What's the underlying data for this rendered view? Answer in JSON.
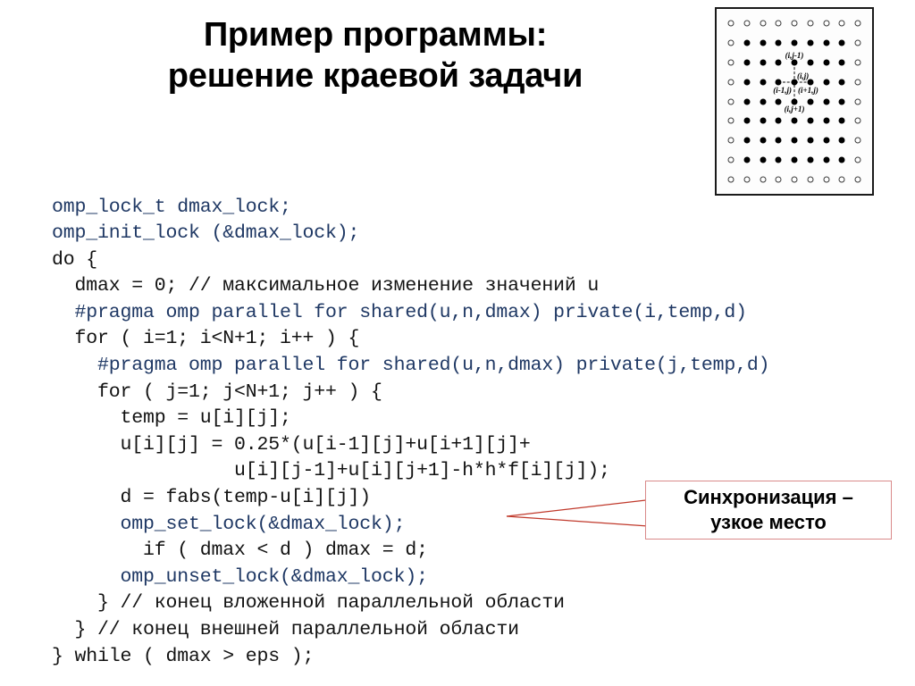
{
  "slide": {
    "title_lines": [
      "Пример программы:",
      "решение краевой задачи"
    ]
  },
  "grid_figure": {
    "name": "finite-difference-stencil-grid",
    "rows": 9,
    "cols": 9,
    "labels": [
      {
        "id": "up",
        "text": "(i,j-1)"
      },
      {
        "id": "center",
        "text": "(i,j)"
      },
      {
        "id": "left",
        "text": "(i-1,j)"
      },
      {
        "id": "right",
        "text": "(i+1,j)"
      },
      {
        "id": "down",
        "text": "(i,j+1)"
      }
    ]
  },
  "code": {
    "language": "c-openmp",
    "lines": [
      {
        "text": "omp_lock_t dmax_lock;",
        "color": "blue"
      },
      {
        "text": "omp_init_lock (&dmax_lock);",
        "color": "blue"
      },
      {
        "text": "do {",
        "color": "black"
      },
      {
        "text": "  dmax = 0; // максимальное изменение значений u",
        "color": "black"
      },
      {
        "text": "  #pragma omp parallel for shared(u,n,dmax) private(i,temp,d)",
        "color": "blue"
      },
      {
        "text": "  for ( i=1; i<N+1; i++ ) {",
        "color": "black"
      },
      {
        "text": "    #pragma omp parallel for shared(u,n,dmax) private(j,temp,d)",
        "color": "blue"
      },
      {
        "text": "    for ( j=1; j<N+1; j++ ) {",
        "color": "black"
      },
      {
        "text": "      temp = u[i][j];",
        "color": "black"
      },
      {
        "text": "      u[i][j] = 0.25*(u[i-1][j]+u[i+1][j]+",
        "color": "black"
      },
      {
        "text": "                u[i][j-1]+u[i][j+1]-h*h*f[i][j]);",
        "color": "black"
      },
      {
        "text": "      d = fabs(temp-u[i][j])",
        "color": "black"
      },
      {
        "text": "      omp_set_lock(&dmax_lock);",
        "color": "blue"
      },
      {
        "text": "        if ( dmax < d ) dmax = d;",
        "color": "black"
      },
      {
        "text": "      omp_unset_lock(&dmax_lock);",
        "color": "blue"
      },
      {
        "text": "    } // конец вложенной параллельной области",
        "color": "black"
      },
      {
        "text": "  } // конец внешней параллельной области",
        "color": "black"
      },
      {
        "text": "} while ( dmax > eps );",
        "color": "black"
      }
    ]
  },
  "callout": {
    "lines": [
      "Синхронизация –",
      "узкое место"
    ],
    "border_color": "#d98a8a",
    "leader_color": "#c0392b"
  },
  "colors": {
    "code_blue": "#1f3864",
    "code_black": "#121212",
    "background": "#ffffff",
    "title": "#000000"
  }
}
